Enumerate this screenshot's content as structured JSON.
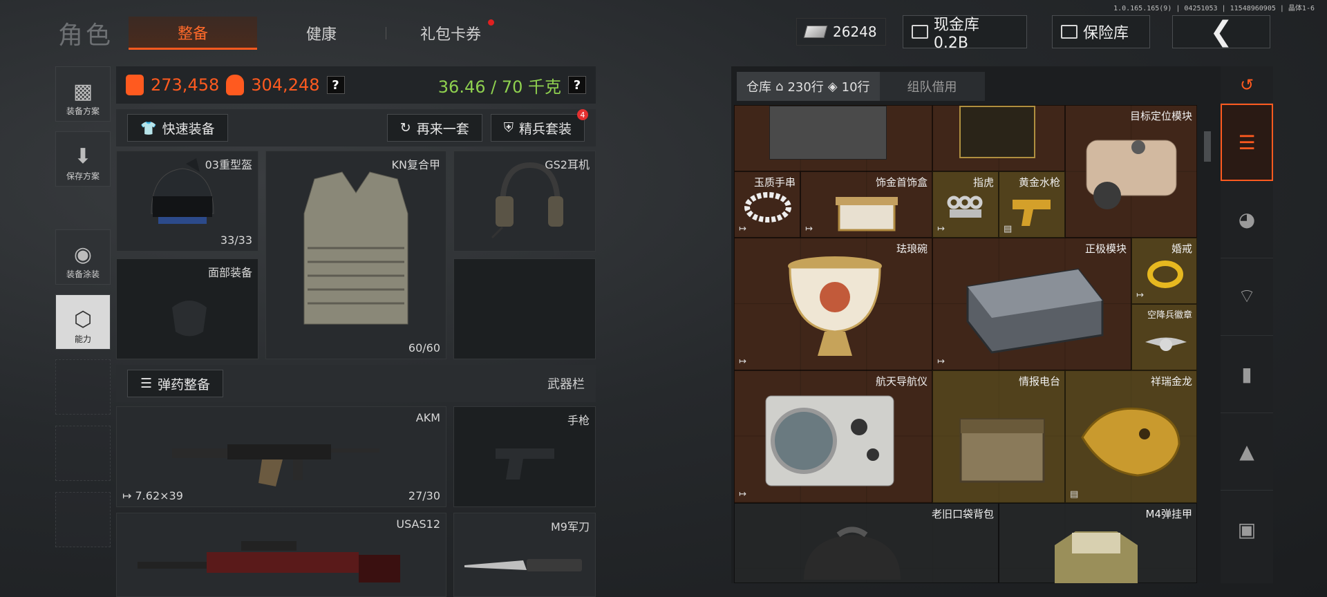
{
  "version": "1.0.165.165(9) | 04251053 | 11548960905 | 晶体1-6",
  "page_title": "角色",
  "tabs": [
    {
      "label": "整备",
      "active": true
    },
    {
      "label": "健康",
      "active": false
    },
    {
      "label": "礼包卡券",
      "active": false,
      "notification": true
    }
  ],
  "header": {
    "cash": "26248",
    "cash_vault": "现金库 0.2B",
    "safe": "保险库",
    "back_icon": "chevron-left-icon"
  },
  "side_nav": [
    {
      "label": "装备方案",
      "icon": "vest-icon",
      "active": false
    },
    {
      "label": "保存方案",
      "icon": "download-icon",
      "active": false
    },
    {
      "label": "装备涂装",
      "icon": "helmet-paint-icon",
      "active": false
    },
    {
      "label": "能力",
      "icon": "ability-icon",
      "active": true
    }
  ],
  "stats": {
    "armor_value": "273,458",
    "backpack_value": "304,248",
    "weight": "36.46 / 70 千克",
    "help": "?"
  },
  "actions": {
    "quick_equip": "快速装备",
    "again": "再来一套",
    "elite_set": "精兵套装",
    "elite_badge": "4",
    "ammo_equip": "弹药整备",
    "weapon_bar": "武器栏"
  },
  "slots": {
    "helmet": {
      "name": "03重型盔",
      "durability": "33/33"
    },
    "armor": {
      "name": "KN复合甲",
      "durability": "60/60"
    },
    "headset": {
      "name": "GS2耳机"
    },
    "face": {
      "name": "面部装备"
    },
    "primary": {
      "name": "AKM",
      "caliber": "7.62×39",
      "ammo": "27/30"
    },
    "pistol": {
      "name": "手枪"
    },
    "secondary": {
      "name": "USAS12"
    },
    "melee": {
      "name": "M9军刀"
    }
  },
  "storage": {
    "tab_label": "仓库",
    "rows_total": "230行",
    "rows_extra": "10行",
    "team_borrow": "组队借用",
    "items": [
      {
        "name": "目标定位模块",
        "color": "brown"
      },
      {
        "name": "玉质手串",
        "color": "brown"
      },
      {
        "name": "饰金首饰盒",
        "color": "brown"
      },
      {
        "name": "指虎",
        "color": "gold"
      },
      {
        "name": "黄金水枪",
        "color": "gold"
      },
      {
        "name": "珐琅碗",
        "color": "brown"
      },
      {
        "name": "正极模块",
        "color": "brown"
      },
      {
        "name": "婚戒",
        "color": "gold"
      },
      {
        "name": "空降兵徽章",
        "color": "gold"
      },
      {
        "name": "航天导航仪",
        "color": "brown"
      },
      {
        "name": "情报电台",
        "color": "gold"
      },
      {
        "name": "祥瑞金龙",
        "color": "gold"
      },
      {
        "name": "老旧口袋背包",
        "color": "gray"
      },
      {
        "name": "M4弹挂甲",
        "color": "gray"
      }
    ]
  },
  "filters": [
    "refresh-icon",
    "stack-icon",
    "helmet-icon",
    "rifle-icon",
    "magazine-icon",
    "ammo-icon",
    "scope-icon"
  ]
}
